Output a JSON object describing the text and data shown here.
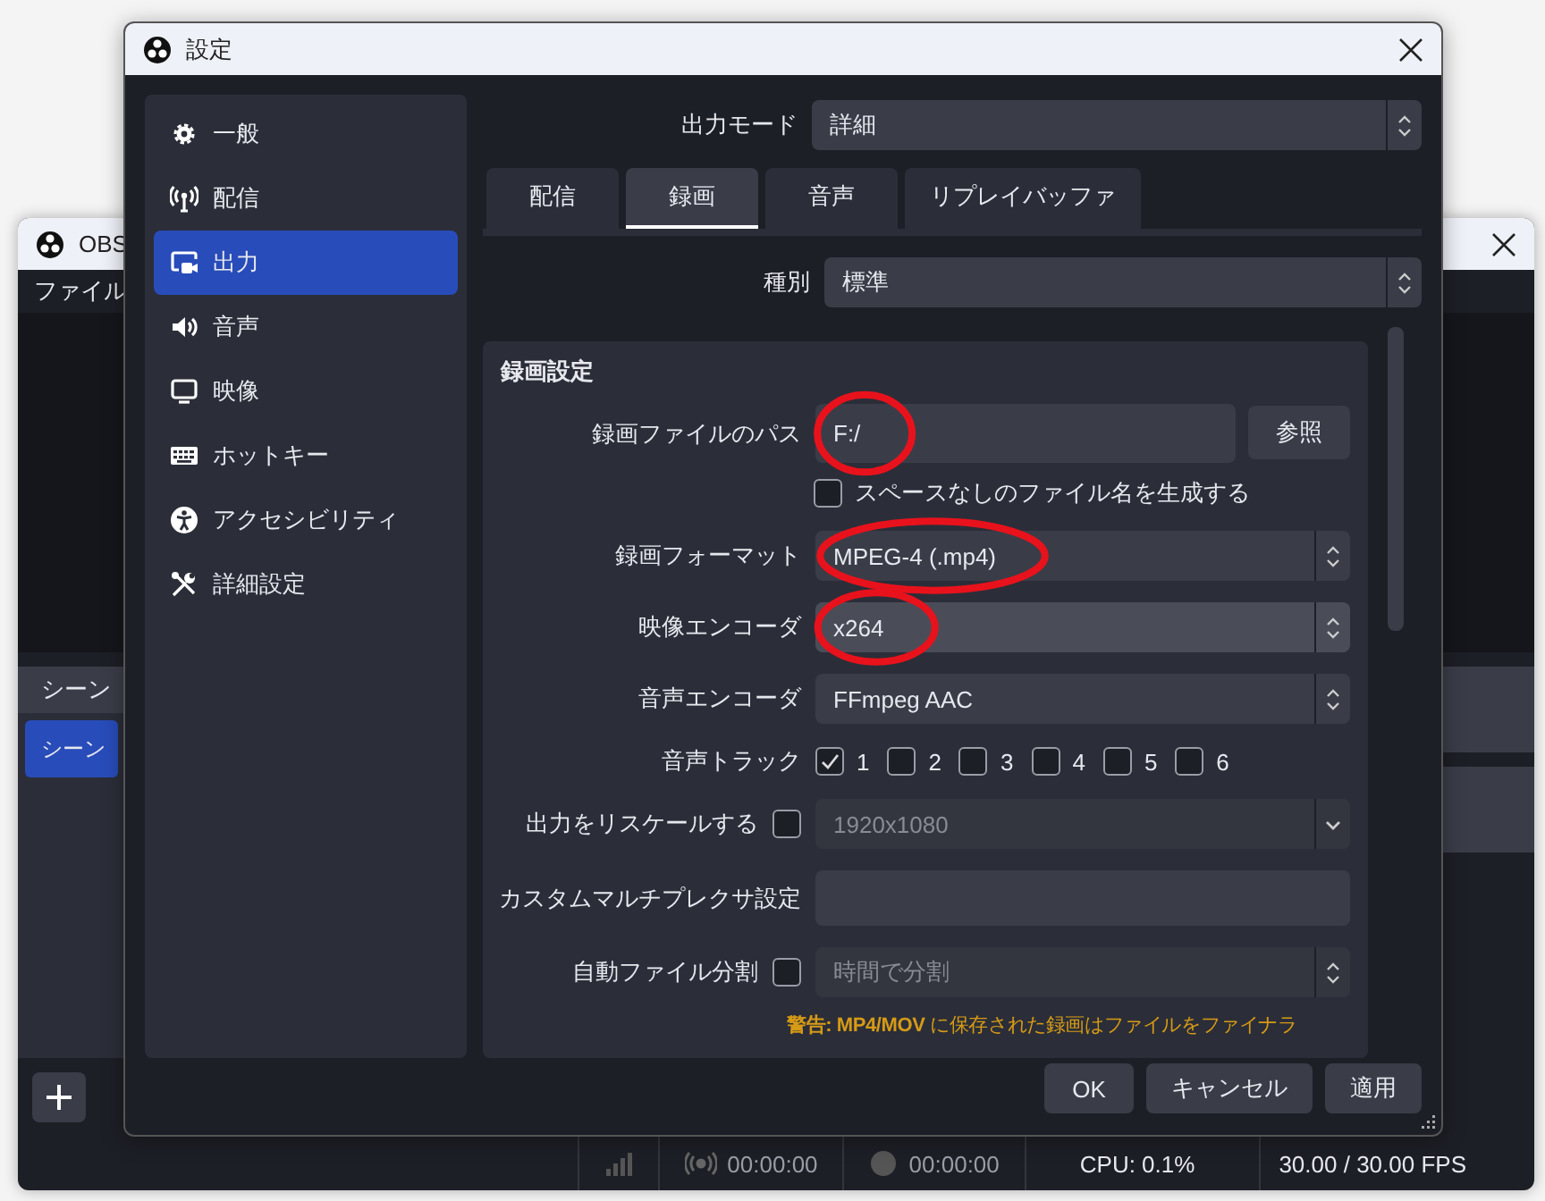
{
  "main_window": {
    "title": "OBS",
    "menu": [
      "ファイル"
    ],
    "scenes_panel": {
      "title": "シーン",
      "scenes": [
        {
          "label": "シーン",
          "selected": true
        }
      ]
    },
    "status_bar": {
      "stream_time": "00:00:00",
      "record_time": "00:00:00",
      "cpu": "CPU: 0.1%",
      "fps": "30.00 / 30.00 FPS"
    }
  },
  "dialog": {
    "title": "設定",
    "sidebar": [
      {
        "label": "一般",
        "selected": false
      },
      {
        "label": "配信",
        "selected": false
      },
      {
        "label": "出力",
        "selected": true
      },
      {
        "label": "音声",
        "selected": false
      },
      {
        "label": "映像",
        "selected": false
      },
      {
        "label": "ホットキー",
        "selected": false
      },
      {
        "label": "アクセシビリティ",
        "selected": false
      },
      {
        "label": "詳細設定",
        "selected": false
      }
    ],
    "output_mode": {
      "label": "出力モード",
      "value": "詳細"
    },
    "tabs": [
      {
        "label": "配信",
        "selected": false
      },
      {
        "label": "録画",
        "selected": true
      },
      {
        "label": "音声",
        "selected": false
      },
      {
        "label": "リプレイバッファ",
        "selected": false
      }
    ],
    "type": {
      "label": "種別",
      "value": "標準"
    },
    "group_title": "録画設定",
    "rows": [
      {
        "kind": "path",
        "label": "録画ファイルのパス",
        "value": "F:/",
        "button": "参照",
        "highlighted": true
      },
      {
        "kind": "checkbox",
        "label": "スペースなしのファイル名を生成する",
        "checked": false
      },
      {
        "kind": "select",
        "label": "録画フォーマット",
        "value": "MPEG-4 (.mp4)",
        "highlighted": true
      },
      {
        "kind": "select",
        "label": "映像エンコーダ",
        "value": "x264",
        "highlighted": true,
        "focused": true
      },
      {
        "kind": "select",
        "label": "音声エンコーダ",
        "value": "FFmpeg AAC"
      },
      {
        "kind": "tracks",
        "label": "音声トラック",
        "tracks": [
          {
            "label": "1",
            "checked": true
          },
          {
            "label": "2",
            "checked": false
          },
          {
            "label": "3",
            "checked": false
          },
          {
            "label": "4",
            "checked": false
          },
          {
            "label": "5",
            "checked": false
          },
          {
            "label": "6",
            "checked": false
          }
        ]
      },
      {
        "kind": "check-combo",
        "label": "出力をリスケールする",
        "checked": false,
        "value": "1920x1080",
        "disabled": true
      },
      {
        "kind": "text",
        "label": "カスタムマルチプレクサ設定"
      },
      {
        "kind": "check-select",
        "label": "自動ファイル分割",
        "checked": false,
        "value": "時間で分割",
        "disabled": true
      },
      {
        "kind": "warning",
        "text": "**警告: MP4/MOV** に保存された録画はファイルをファイナラ"
      }
    ],
    "buttons": [
      "OK",
      "キャンセル",
      "適用"
    ]
  }
}
